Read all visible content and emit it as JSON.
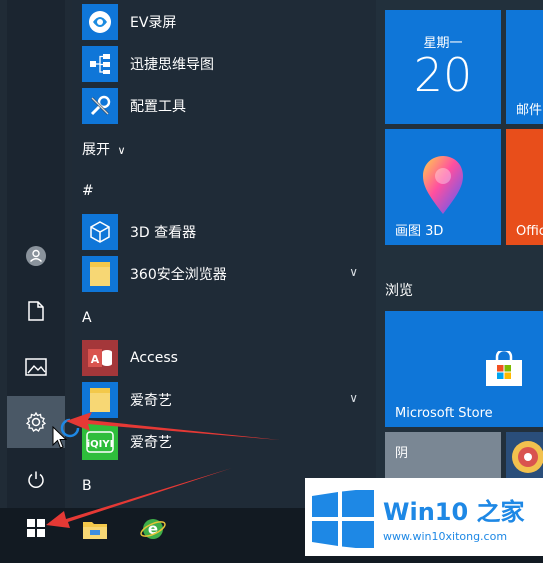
{
  "app_list": {
    "items_top": [
      {
        "label": "EV录屏",
        "icon": "ev-recorder-icon"
      },
      {
        "label": "迅捷思维导图",
        "icon": "mindmap-icon"
      },
      {
        "label": "配置工具",
        "icon": "config-tool-icon"
      }
    ],
    "expand_label": "展开",
    "section_hash": "#",
    "items_hash": [
      {
        "label": "3D 查看器",
        "icon": "3d-viewer-icon"
      },
      {
        "label": "360安全浏览器",
        "icon": "folder-icon"
      }
    ],
    "section_a": "A",
    "items_a": [
      {
        "label": "Access",
        "icon": "access-icon"
      },
      {
        "label": "爱奇艺",
        "icon": "folder-icon"
      },
      {
        "label": "爱奇艺",
        "icon": "iqiyi-icon"
      }
    ],
    "section_b": "B"
  },
  "tiles": {
    "calendar_weekday": "星期一",
    "calendar_day": "20",
    "mail_label": "邮件",
    "paint3d_label": "画图 3D",
    "office_label": "Offic",
    "browse_group": "浏览",
    "store_label": "Microsoft Store",
    "weather_label": "阴"
  },
  "watermark": {
    "brand": "Win10 之家",
    "url": "www.win10xitong.com"
  },
  "colors": {
    "accent": "#0f76d8",
    "office": "#e84e1b",
    "arrow": "#e53935"
  }
}
